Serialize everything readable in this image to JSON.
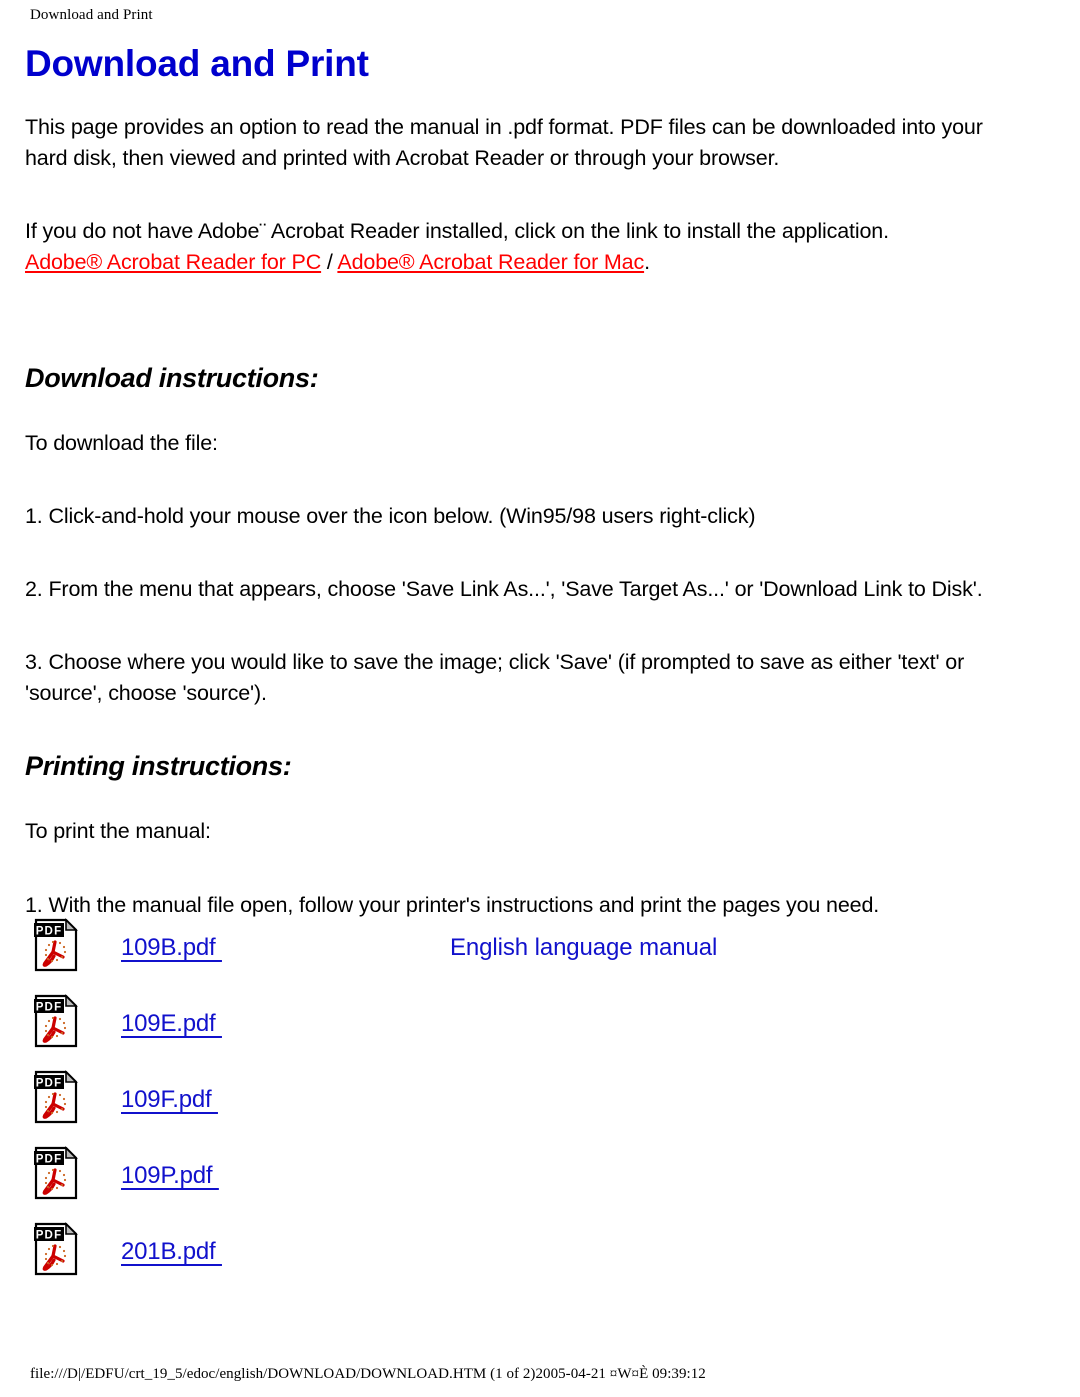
{
  "browser_chrome": {
    "header_title": "Download and Print",
    "footer_status": "file:///D|/EDFU/crt_19_5/edoc/english/DOWNLOAD/DOWNLOAD.HTM (1 of 2)2005-04-21 ¤W¤È 09:39:12"
  },
  "page": {
    "title": "Download and Print",
    "intro_paragraph": "This page provides an option to read the manual in .pdf format. PDF files can be downloaded into your hard disk, then viewed and printed with Acrobat Reader or through your browser.",
    "reader_paragraph": "If you do not have Adobe¨ Acrobat Reader installed, click on the link to install the application.",
    "reader_link_pc": "Adobe® Acrobat Reader for PC",
    "reader_link_separator": " / ",
    "reader_link_mac": "Adobe® Acrobat Reader for Mac",
    "reader_link_trailing": "."
  },
  "download_section": {
    "heading": "Download instructions:",
    "lead": "To download the file:",
    "steps": [
      "1. Click-and-hold your mouse over the icon below. (Win95/98 users right-click)",
      "2. From the menu that appears, choose 'Save Link As...', 'Save Target As...' or 'Download Link to Disk'.",
      "3. Choose where you would like to save the image; click 'Save' (if prompted to save as either 'text' or 'source', choose 'source')."
    ]
  },
  "printing_section": {
    "heading": "Printing instructions:",
    "lead": "To print the manual:",
    "steps": [
      "1. With the manual file open, follow your printer's instructions and print the pages you need."
    ]
  },
  "pdf_files": [
    {
      "icon": "pdf-file-icon",
      "label": "109B.pdf ",
      "description": "English language manual"
    },
    {
      "icon": "pdf-file-icon",
      "label": "109E.pdf ",
      "description": ""
    },
    {
      "icon": "pdf-file-icon",
      "label": "109F.pdf ",
      "description": ""
    },
    {
      "icon": "pdf-file-icon",
      "label": "109P.pdf ",
      "description": ""
    },
    {
      "icon": "pdf-file-icon",
      "label": "201B.pdf ",
      "description": ""
    }
  ],
  "colors": {
    "title_blue": "#0000CD",
    "link_blue": "#1111CC",
    "link_red": "#FF0000",
    "text_black": "#000000",
    "icon_red": "#CC0000",
    "background": "#FFFFFF"
  }
}
